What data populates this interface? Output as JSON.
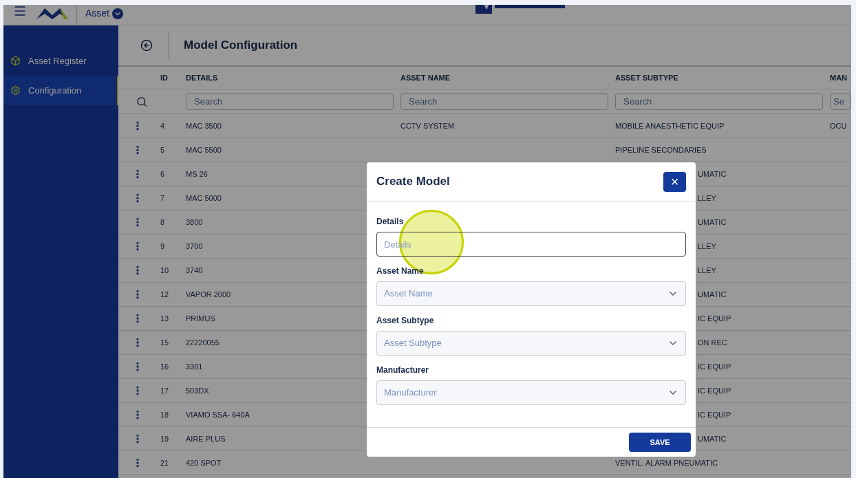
{
  "header": {
    "module": "Asset"
  },
  "sidebar": {
    "items": [
      {
        "label": "Asset Register",
        "selected": false
      },
      {
        "label": "Configuration",
        "selected": true
      }
    ]
  },
  "page": {
    "title": "Model Configuration"
  },
  "table": {
    "columns": [
      "ID",
      "DETAILS",
      "ASSET NAME",
      "ASSET SUBTYPE",
      "MAN"
    ],
    "search_placeholders": [
      "Search",
      "Search",
      "Search",
      "Se"
    ],
    "rows": [
      {
        "id": "4",
        "details": "MAC 3500",
        "asset_name": "CCTV SYSTEM",
        "asset_subtype": "MOBILE ANAESTHETIC EQUIP",
        "manufacturer": "OCU"
      },
      {
        "id": "5",
        "details": "MAC 5500",
        "asset_subtype": "PIPELINE SECONDARIES"
      },
      {
        "id": "6",
        "details": "MS 26",
        "asset_subtype_tail": "UMATIC"
      },
      {
        "id": "7",
        "details": "MAC 5000",
        "asset_subtype_tail": "LLEY"
      },
      {
        "id": "8",
        "details": "3800",
        "asset_subtype_tail": "UMATIC"
      },
      {
        "id": "9",
        "details": "3700",
        "asset_subtype_tail": "LLEY"
      },
      {
        "id": "10",
        "details": "3740",
        "asset_subtype_tail": "LLEY"
      },
      {
        "id": "12",
        "details": "VAPOR 2000",
        "asset_subtype_tail": "UMATIC"
      },
      {
        "id": "13",
        "details": "PRIMUS",
        "asset_subtype_tail": "IC EQUIP"
      },
      {
        "id": "15",
        "details": "22220055",
        "asset_subtype_tail": "ON REC"
      },
      {
        "id": "16",
        "details": "3301",
        "asset_subtype_tail": "IC EQUIP"
      },
      {
        "id": "17",
        "details": "503DX",
        "asset_subtype_tail": "IC EQUIP"
      },
      {
        "id": "18",
        "details": "VIAMO SSA- 640A",
        "asset_subtype_tail": "IC EQUIP"
      },
      {
        "id": "19",
        "details": "AIRE PLUS",
        "asset_subtype_tail": "UMATIC"
      },
      {
        "id": "21",
        "details": "420 SPOT",
        "asset_subtype": "VENTIL. ALARM PNEUMATIC"
      }
    ]
  },
  "modal": {
    "title": "Create Model",
    "close": "×",
    "fields": [
      {
        "kind": "text",
        "label": "Details",
        "placeholder": "Details"
      },
      {
        "kind": "select",
        "label": "Asset Name",
        "placeholder": "Asset Name"
      },
      {
        "kind": "select",
        "label": "Asset Subtype",
        "placeholder": "Asset Subtype"
      },
      {
        "kind": "select",
        "label": "Manufacturer",
        "placeholder": "Manufacturer"
      }
    ],
    "save": "SAVE"
  }
}
